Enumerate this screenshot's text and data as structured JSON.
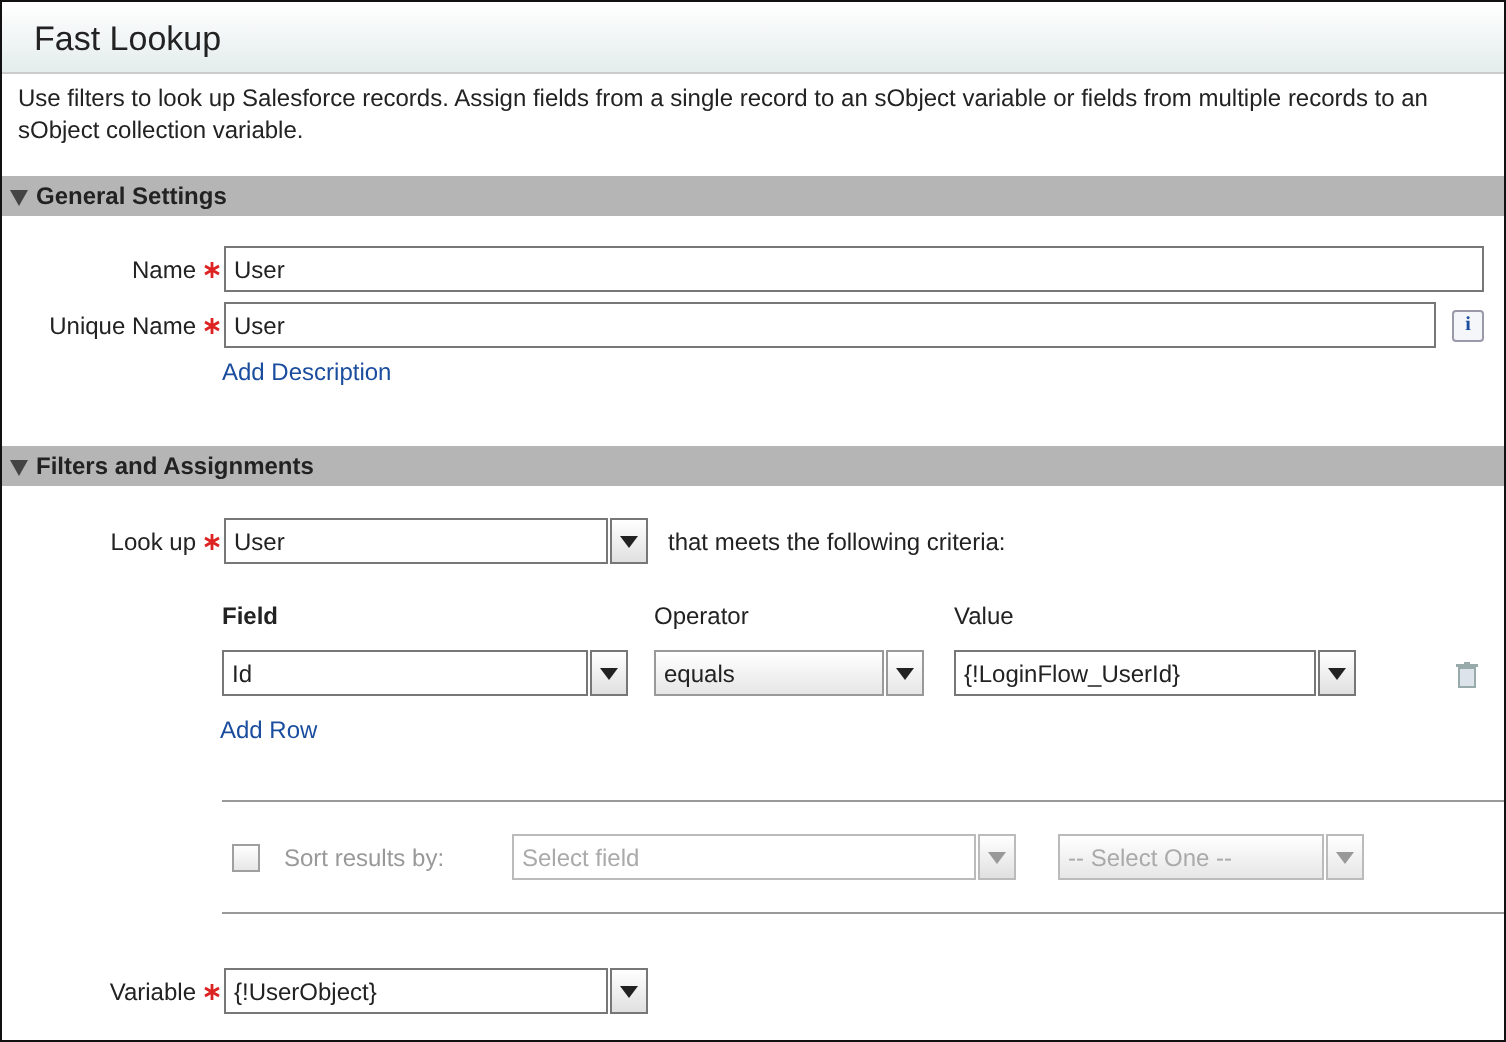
{
  "title": "Fast Lookup",
  "description": "Use filters to look up Salesforce records. Assign fields from a single record to an sObject variable or fields from multiple records to an sObject collection variable.",
  "general_settings": {
    "heading": "General Settings",
    "expanded": true,
    "fields": [
      {
        "label": "Name",
        "required": true,
        "value": "User"
      },
      {
        "label": "Unique Name",
        "required": true,
        "value": "User",
        "info": "i"
      }
    ],
    "link": "Add Description"
  },
  "filters": {
    "heading": "Filters and Assignments",
    "expanded": true,
    "lookup": {
      "label": "Look up",
      "required": true,
      "value": "User",
      "suffix": "that meets the following criteria:"
    },
    "columns": [
      "Field",
      "Operator",
      "Value"
    ],
    "rows": [
      {
        "field": "Id",
        "operator": "equals",
        "value": "{!LoginFlow_UserId}"
      }
    ],
    "link": "Add Row",
    "sort": {
      "checked": false,
      "disabled": true,
      "label": "Sort results by:",
      "field_placeholder": "Select field",
      "order": "-- Select One --"
    },
    "variable": {
      "label": "Variable",
      "required": true,
      "value": "{!UserObject}"
    }
  }
}
